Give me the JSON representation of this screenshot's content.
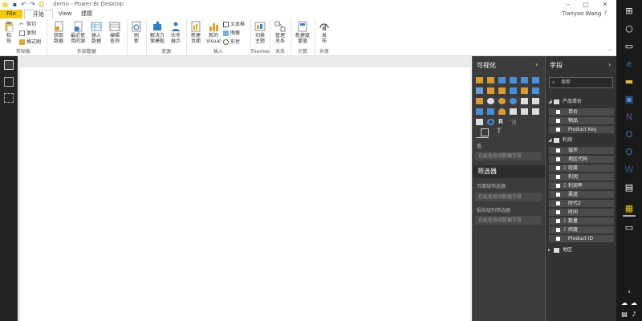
{
  "window": {
    "title": "demo - Power BI Desktop",
    "user": "Tianyao Wang",
    "minimize": "–",
    "maximize": "▢",
    "close": "✕"
  },
  "tabs": [
    "File",
    "开始",
    "View",
    "建模"
  ],
  "ribbon": {
    "clipboard": {
      "paste": "粘\n贴",
      "cut": "剪切",
      "copy": "复制",
      "format": "格式刷",
      "label": "剪贴板"
    },
    "external": {
      "get": "获取\n数据",
      "recent": "最近使\n用的源",
      "enter": "输入\n数据",
      "edit": "编辑\n查询",
      "label": "外部数据"
    },
    "refresh": {
      "refresh": "刷\n新"
    },
    "resources": {
      "solution": "解决方\n案模板",
      "partner": "伙伴\n展示",
      "label": "资源"
    },
    "insert": {
      "newpage": "新建\n页面",
      "newvisual": "新的\nVisual",
      "textbox": "文本框",
      "image": "图像",
      "shapes": "形状",
      "label": "插入"
    },
    "themes": {
      "switch": "切换\n主题",
      "label": "Themes"
    },
    "relationships": {
      "manage": "管理\n关系",
      "label": "关系"
    },
    "calculations": {
      "newmeasure": "新建度\n量值",
      "label": "计算"
    },
    "share": {
      "publish": "发\n布",
      "label": "共享"
    }
  },
  "viz": {
    "title": "可视化",
    "values_label": "值",
    "values_placeholder": "在此处拖动数据字段",
    "filters_title": "筛选器",
    "page_filter": "页面级筛选器",
    "page_placeholder": "在此处拖动数据字段",
    "report_filter": "报告级别筛选器",
    "report_placeholder": "在此处拖动数据字段"
  },
  "fields": {
    "title": "字段",
    "search_placeholder": "搜索",
    "tables": [
      {
        "name": "产品单价",
        "fields": [
          {
            "sigma": "",
            "name": "单价"
          },
          {
            "sigma": "",
            "name": "物品"
          },
          {
            "sigma": "",
            "name": "Product Key"
          }
        ]
      },
      {
        "name": "利润",
        "fields": [
          {
            "sigma": "",
            "name": "城市"
          },
          {
            "sigma": "",
            "name": "地区代码"
          },
          {
            "sigma": "Σ",
            "name": "经度"
          },
          {
            "sigma": "",
            "name": "利润"
          },
          {
            "sigma": "Σ",
            "name": "利润率"
          },
          {
            "sigma": "",
            "name": "渠道"
          },
          {
            "sigma": "",
            "name": "时代2"
          },
          {
            "sigma": "",
            "name": "时间"
          },
          {
            "sigma": "Σ",
            "name": "数量"
          },
          {
            "sigma": "Σ",
            "name": "纬度"
          },
          {
            "sigma": "",
            "name": "Product ID"
          }
        ]
      },
      {
        "name": "地区",
        "fields": []
      }
    ]
  },
  "colors": {
    "accent": "#f2c811",
    "dark_pane": "#3c3c3c",
    "fields_pane": "#333333"
  }
}
